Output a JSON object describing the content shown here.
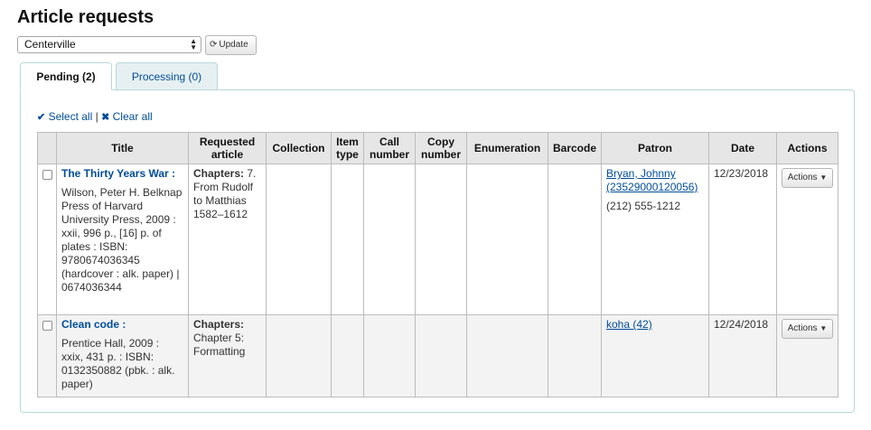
{
  "page": {
    "title": "Article requests"
  },
  "filter": {
    "library": "Centerville",
    "update_label": "Update"
  },
  "tabs": [
    {
      "label": "Pending (2)",
      "active": true
    },
    {
      "label": "Processing (0)",
      "active": false
    }
  ],
  "selection": {
    "select_all": "Select all",
    "separator": "|",
    "clear_all": "Clear all"
  },
  "table": {
    "columns": [
      "Title",
      "Requested article",
      "Collection",
      "Item type",
      "Call number",
      "Copy number",
      "Enumeration",
      "Barcode",
      "Patron",
      "Date",
      "Actions"
    ],
    "rows": [
      {
        "title": "The Thirty Years War :",
        "biblio": "Wilson, Peter H. Belknap Press of Harvard University Press, 2009 : xxii, 996 p., [16] p. of plates : ISBN: 9780674036345 (hardcover : alk. paper) | 0674036344",
        "chapters_label": "Chapters:",
        "chapters_value": " 7. From Rudolf to Matthias 1582–1612",
        "collection": "",
        "item_type": "",
        "call_number": "",
        "copy_number": "",
        "enumeration": "",
        "barcode": "",
        "patron": "Bryan, Johnny (23529000120056)",
        "phone": "(212) 555-1212",
        "date": "12/23/2018",
        "actions_label": "Actions"
      },
      {
        "title": "Clean code :",
        "biblio": "Prentice Hall, 2009 : xxix, 431 p. : ISBN: 0132350882 (pbk. : alk. paper)",
        "chapters_label": "Chapters:",
        "chapters_value": " Chapter 5: Formatting",
        "collection": "",
        "item_type": "",
        "call_number": "",
        "copy_number": "",
        "enumeration": "",
        "barcode": "",
        "patron": "koha (42)",
        "phone": "",
        "date": "12/24/2018",
        "actions_label": "Actions"
      }
    ]
  },
  "icons": {
    "select_all": "check-icon",
    "clear_all": "x-icon",
    "update": "refresh-icon",
    "actions": "caret-down-icon"
  },
  "colors": {
    "link": "#004d99",
    "tab_border": "#b9d8d9",
    "header_bg": "#e6e6e6",
    "row_alt_bg": "#f3f3f3"
  }
}
